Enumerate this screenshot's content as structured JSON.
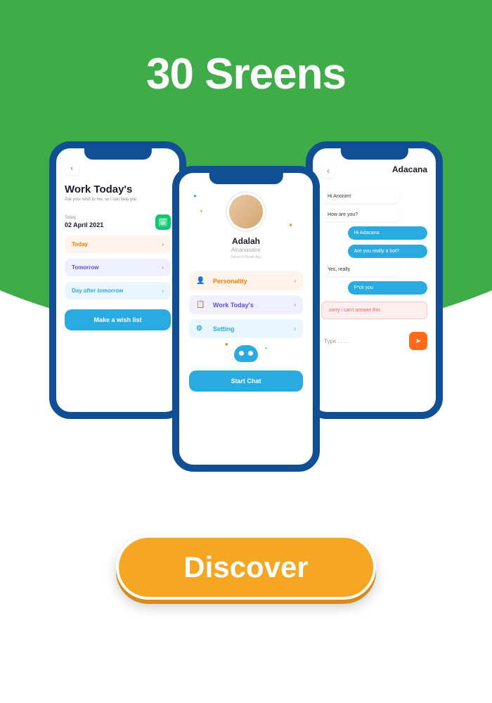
{
  "header": {
    "title": "30 Sreens"
  },
  "phone_left": {
    "heading": "Work Today's",
    "subtitle": "Ask your wish to me, so I can help you",
    "today_label": "Today",
    "date": "02 April 2021",
    "options": {
      "today": "Today",
      "tomorrow": "Tomorrow",
      "day_after": "Day after tomorrow"
    },
    "cta": "Make a wish list"
  },
  "phone_center": {
    "name": "Adalah",
    "username": "Alcanasatre",
    "joined": "Joined 6 Month Ago",
    "menu": {
      "personality": "Personality",
      "work": "Work Today's",
      "setting": "Setting"
    },
    "cta": "Start Chat"
  },
  "phone_right": {
    "title": "Adacana",
    "messages": {
      "m1": "Hi Anonim!",
      "m2": "How are you?",
      "m3": "Hi Adacana",
      "m4": "Are you really a bot?",
      "m5": "Yes, really",
      "m6": "F*ck you",
      "warn": "sorry i can't answer this"
    },
    "input_placeholder": "Type . . . ."
  },
  "discover": {
    "label": "Discover"
  }
}
